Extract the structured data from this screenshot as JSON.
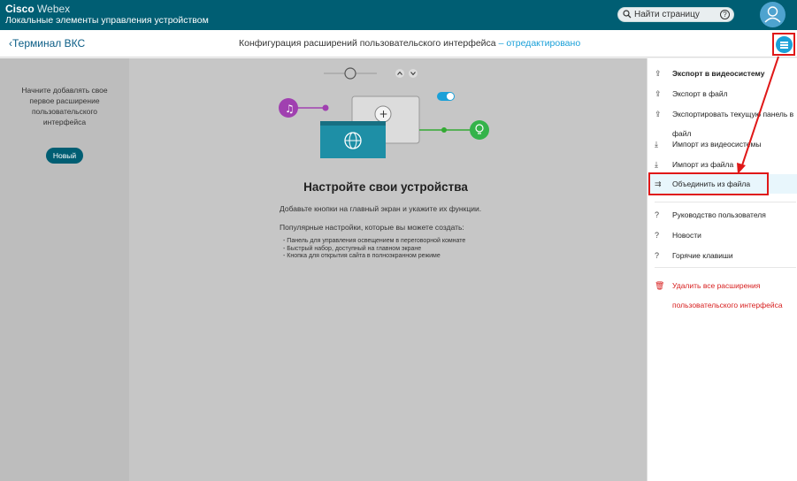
{
  "header": {
    "brand_part1": "Cisco",
    "brand_part2": "Webex",
    "subtitle": "Локальные элементы управления устройством",
    "search_placeholder": "Найти страницу",
    "search_help": "?"
  },
  "subheader": {
    "back_label": "Терминал ВКС",
    "title": "Конфигурация расширений пользовательского интерфейса",
    "edited": "– отредактировано"
  },
  "left_panel": {
    "hint": "Начните добавлять свое первое расширение пользовательского интерфейса",
    "new_button": "Новый"
  },
  "center": {
    "heading": "Настройте свои устройства",
    "description": "Добавьте кнопки на главный экран и укажите их функции.",
    "popular_title": "Популярные настройки, которые вы можете создать:",
    "popular_items": [
      "Панель для управления освещением в переговорной комнате",
      "Быстрый набор, доступный на главном экране",
      "Кнопка для открытия сайта в полноэкранном режиме"
    ]
  },
  "menu": {
    "items": [
      {
        "label": "Экспорт в видеосистему",
        "icon": "upload-icon"
      },
      {
        "label": "Экспорт в файл",
        "icon": "upload-icon"
      },
      {
        "label": "Экспортировать текущую панель в файл",
        "icon": "upload-icon"
      },
      {
        "label": "Импорт из видеосистемы",
        "icon": "download-icon"
      },
      {
        "label": "Импорт из файла",
        "icon": "download-icon"
      },
      {
        "label": "Объединить из файла",
        "icon": "merge-icon"
      },
      {
        "label": "Руководство пользователя",
        "icon": "help-icon"
      },
      {
        "label": "Новости",
        "icon": "help-icon"
      },
      {
        "label": "Горячие клавиши",
        "icon": "help-icon"
      },
      {
        "label": "Удалить все расширения пользовательского интерфейса",
        "icon": "trash-icon"
      }
    ]
  },
  "colors": {
    "topbar": "#005e73",
    "accent": "#1aa0d8",
    "highlight": "#e01818",
    "danger": "#d71e1e"
  }
}
